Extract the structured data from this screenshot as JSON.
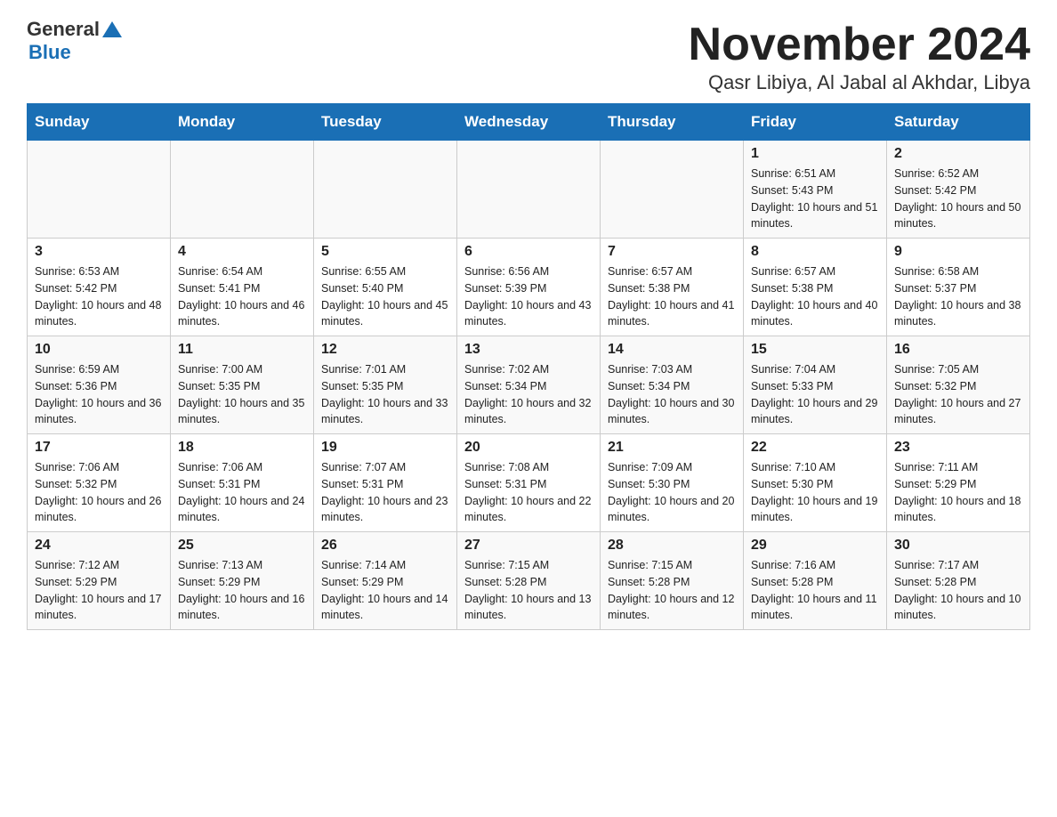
{
  "header": {
    "logo_general": "General",
    "logo_blue": "Blue",
    "title": "November 2024",
    "subtitle": "Qasr Libiya, Al Jabal al Akhdar, Libya"
  },
  "calendar": {
    "days_of_week": [
      "Sunday",
      "Monday",
      "Tuesday",
      "Wednesday",
      "Thursday",
      "Friday",
      "Saturday"
    ],
    "weeks": [
      [
        {
          "day": "",
          "sunrise": "",
          "sunset": "",
          "daylight": ""
        },
        {
          "day": "",
          "sunrise": "",
          "sunset": "",
          "daylight": ""
        },
        {
          "day": "",
          "sunrise": "",
          "sunset": "",
          "daylight": ""
        },
        {
          "day": "",
          "sunrise": "",
          "sunset": "",
          "daylight": ""
        },
        {
          "day": "",
          "sunrise": "",
          "sunset": "",
          "daylight": ""
        },
        {
          "day": "1",
          "sunrise": "Sunrise: 6:51 AM",
          "sunset": "Sunset: 5:43 PM",
          "daylight": "Daylight: 10 hours and 51 minutes."
        },
        {
          "day": "2",
          "sunrise": "Sunrise: 6:52 AM",
          "sunset": "Sunset: 5:42 PM",
          "daylight": "Daylight: 10 hours and 50 minutes."
        }
      ],
      [
        {
          "day": "3",
          "sunrise": "Sunrise: 6:53 AM",
          "sunset": "Sunset: 5:42 PM",
          "daylight": "Daylight: 10 hours and 48 minutes."
        },
        {
          "day": "4",
          "sunrise": "Sunrise: 6:54 AM",
          "sunset": "Sunset: 5:41 PM",
          "daylight": "Daylight: 10 hours and 46 minutes."
        },
        {
          "day": "5",
          "sunrise": "Sunrise: 6:55 AM",
          "sunset": "Sunset: 5:40 PM",
          "daylight": "Daylight: 10 hours and 45 minutes."
        },
        {
          "day": "6",
          "sunrise": "Sunrise: 6:56 AM",
          "sunset": "Sunset: 5:39 PM",
          "daylight": "Daylight: 10 hours and 43 minutes."
        },
        {
          "day": "7",
          "sunrise": "Sunrise: 6:57 AM",
          "sunset": "Sunset: 5:38 PM",
          "daylight": "Daylight: 10 hours and 41 minutes."
        },
        {
          "day": "8",
          "sunrise": "Sunrise: 6:57 AM",
          "sunset": "Sunset: 5:38 PM",
          "daylight": "Daylight: 10 hours and 40 minutes."
        },
        {
          "day": "9",
          "sunrise": "Sunrise: 6:58 AM",
          "sunset": "Sunset: 5:37 PM",
          "daylight": "Daylight: 10 hours and 38 minutes."
        }
      ],
      [
        {
          "day": "10",
          "sunrise": "Sunrise: 6:59 AM",
          "sunset": "Sunset: 5:36 PM",
          "daylight": "Daylight: 10 hours and 36 minutes."
        },
        {
          "day": "11",
          "sunrise": "Sunrise: 7:00 AM",
          "sunset": "Sunset: 5:35 PM",
          "daylight": "Daylight: 10 hours and 35 minutes."
        },
        {
          "day": "12",
          "sunrise": "Sunrise: 7:01 AM",
          "sunset": "Sunset: 5:35 PM",
          "daylight": "Daylight: 10 hours and 33 minutes."
        },
        {
          "day": "13",
          "sunrise": "Sunrise: 7:02 AM",
          "sunset": "Sunset: 5:34 PM",
          "daylight": "Daylight: 10 hours and 32 minutes."
        },
        {
          "day": "14",
          "sunrise": "Sunrise: 7:03 AM",
          "sunset": "Sunset: 5:34 PM",
          "daylight": "Daylight: 10 hours and 30 minutes."
        },
        {
          "day": "15",
          "sunrise": "Sunrise: 7:04 AM",
          "sunset": "Sunset: 5:33 PM",
          "daylight": "Daylight: 10 hours and 29 minutes."
        },
        {
          "day": "16",
          "sunrise": "Sunrise: 7:05 AM",
          "sunset": "Sunset: 5:32 PM",
          "daylight": "Daylight: 10 hours and 27 minutes."
        }
      ],
      [
        {
          "day": "17",
          "sunrise": "Sunrise: 7:06 AM",
          "sunset": "Sunset: 5:32 PM",
          "daylight": "Daylight: 10 hours and 26 minutes."
        },
        {
          "day": "18",
          "sunrise": "Sunrise: 7:06 AM",
          "sunset": "Sunset: 5:31 PM",
          "daylight": "Daylight: 10 hours and 24 minutes."
        },
        {
          "day": "19",
          "sunrise": "Sunrise: 7:07 AM",
          "sunset": "Sunset: 5:31 PM",
          "daylight": "Daylight: 10 hours and 23 minutes."
        },
        {
          "day": "20",
          "sunrise": "Sunrise: 7:08 AM",
          "sunset": "Sunset: 5:31 PM",
          "daylight": "Daylight: 10 hours and 22 minutes."
        },
        {
          "day": "21",
          "sunrise": "Sunrise: 7:09 AM",
          "sunset": "Sunset: 5:30 PM",
          "daylight": "Daylight: 10 hours and 20 minutes."
        },
        {
          "day": "22",
          "sunrise": "Sunrise: 7:10 AM",
          "sunset": "Sunset: 5:30 PM",
          "daylight": "Daylight: 10 hours and 19 minutes."
        },
        {
          "day": "23",
          "sunrise": "Sunrise: 7:11 AM",
          "sunset": "Sunset: 5:29 PM",
          "daylight": "Daylight: 10 hours and 18 minutes."
        }
      ],
      [
        {
          "day": "24",
          "sunrise": "Sunrise: 7:12 AM",
          "sunset": "Sunset: 5:29 PM",
          "daylight": "Daylight: 10 hours and 17 minutes."
        },
        {
          "day": "25",
          "sunrise": "Sunrise: 7:13 AM",
          "sunset": "Sunset: 5:29 PM",
          "daylight": "Daylight: 10 hours and 16 minutes."
        },
        {
          "day": "26",
          "sunrise": "Sunrise: 7:14 AM",
          "sunset": "Sunset: 5:29 PM",
          "daylight": "Daylight: 10 hours and 14 minutes."
        },
        {
          "day": "27",
          "sunrise": "Sunrise: 7:15 AM",
          "sunset": "Sunset: 5:28 PM",
          "daylight": "Daylight: 10 hours and 13 minutes."
        },
        {
          "day": "28",
          "sunrise": "Sunrise: 7:15 AM",
          "sunset": "Sunset: 5:28 PM",
          "daylight": "Daylight: 10 hours and 12 minutes."
        },
        {
          "day": "29",
          "sunrise": "Sunrise: 7:16 AM",
          "sunset": "Sunset: 5:28 PM",
          "daylight": "Daylight: 10 hours and 11 minutes."
        },
        {
          "day": "30",
          "sunrise": "Sunrise: 7:17 AM",
          "sunset": "Sunset: 5:28 PM",
          "daylight": "Daylight: 10 hours and 10 minutes."
        }
      ]
    ]
  }
}
